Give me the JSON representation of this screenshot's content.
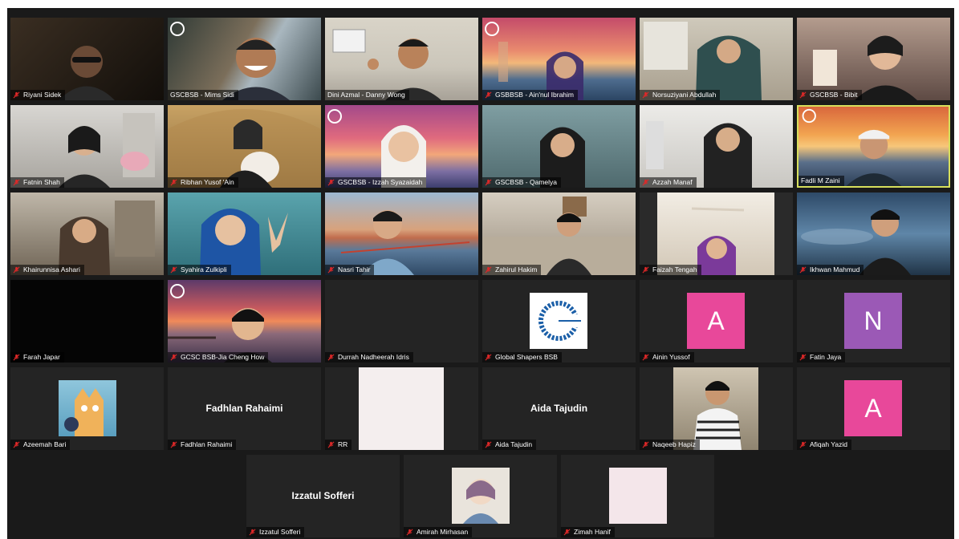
{
  "colors": {
    "background": "#1a1a1a",
    "tile": "#242424",
    "active_border": "#d7df5c",
    "mute_red": "#e02828",
    "avatar_pink": "#e8489a",
    "avatar_purple": "#9b59b6"
  },
  "participants": [
    {
      "name": "Riyani Sidek"
    },
    {
      "name": "GSCBSB - Mims Sidi"
    },
    {
      "name": "Dini Azmal - Danny Wong"
    },
    {
      "name": "GSBBSB - Ain'nul Ibrahim"
    },
    {
      "name": "Norsuziyani Abdullah"
    },
    {
      "name": "GSCBSB - Bibit"
    },
    {
      "name": "Fatnin Shah"
    },
    {
      "name": "Ribhan Yusof 'Ain"
    },
    {
      "name": "GSCBSB - Izzah Syazaidah"
    },
    {
      "name": "GSCBSB - Qamelya"
    },
    {
      "name": "Azzah Manaf"
    },
    {
      "name": "Fadli M Zaini"
    },
    {
      "name": "Khairunnisa Ashari"
    },
    {
      "name": "Syahira Zulkipli"
    },
    {
      "name": "Nasri Tahir"
    },
    {
      "name": "Zahirul Hakim"
    },
    {
      "name": "Faizah Tengah"
    },
    {
      "name": "Ikhwan Mahmud"
    },
    {
      "name": "Farah Japar"
    },
    {
      "name": "GCSC BSB-Jia Cheng How"
    },
    {
      "name": "Durrah Nadheerah Idris"
    },
    {
      "name": "Global Shapers BSB"
    },
    {
      "name": "Ainin Yussof",
      "avatar_letter": "A"
    },
    {
      "name": "Fatin Jaya",
      "avatar_letter": "N"
    },
    {
      "name": "Azeemah Bari"
    },
    {
      "name": "Fadhlan Rahaimi",
      "display_name": "Fadhlan Rahaimi"
    },
    {
      "name": "RR"
    },
    {
      "name": "Aida Tajudin",
      "display_name": "Aida Tajudin"
    },
    {
      "name": "Naqeeb Hapiz"
    },
    {
      "name": "Afiqah Yazid",
      "avatar_letter": "A"
    },
    {
      "name": "Izzatul Sofferi",
      "display_name": "Izzatul Sofferi"
    },
    {
      "name": "Amirah Mirhasan"
    },
    {
      "name": "Zimah Hanif"
    }
  ]
}
